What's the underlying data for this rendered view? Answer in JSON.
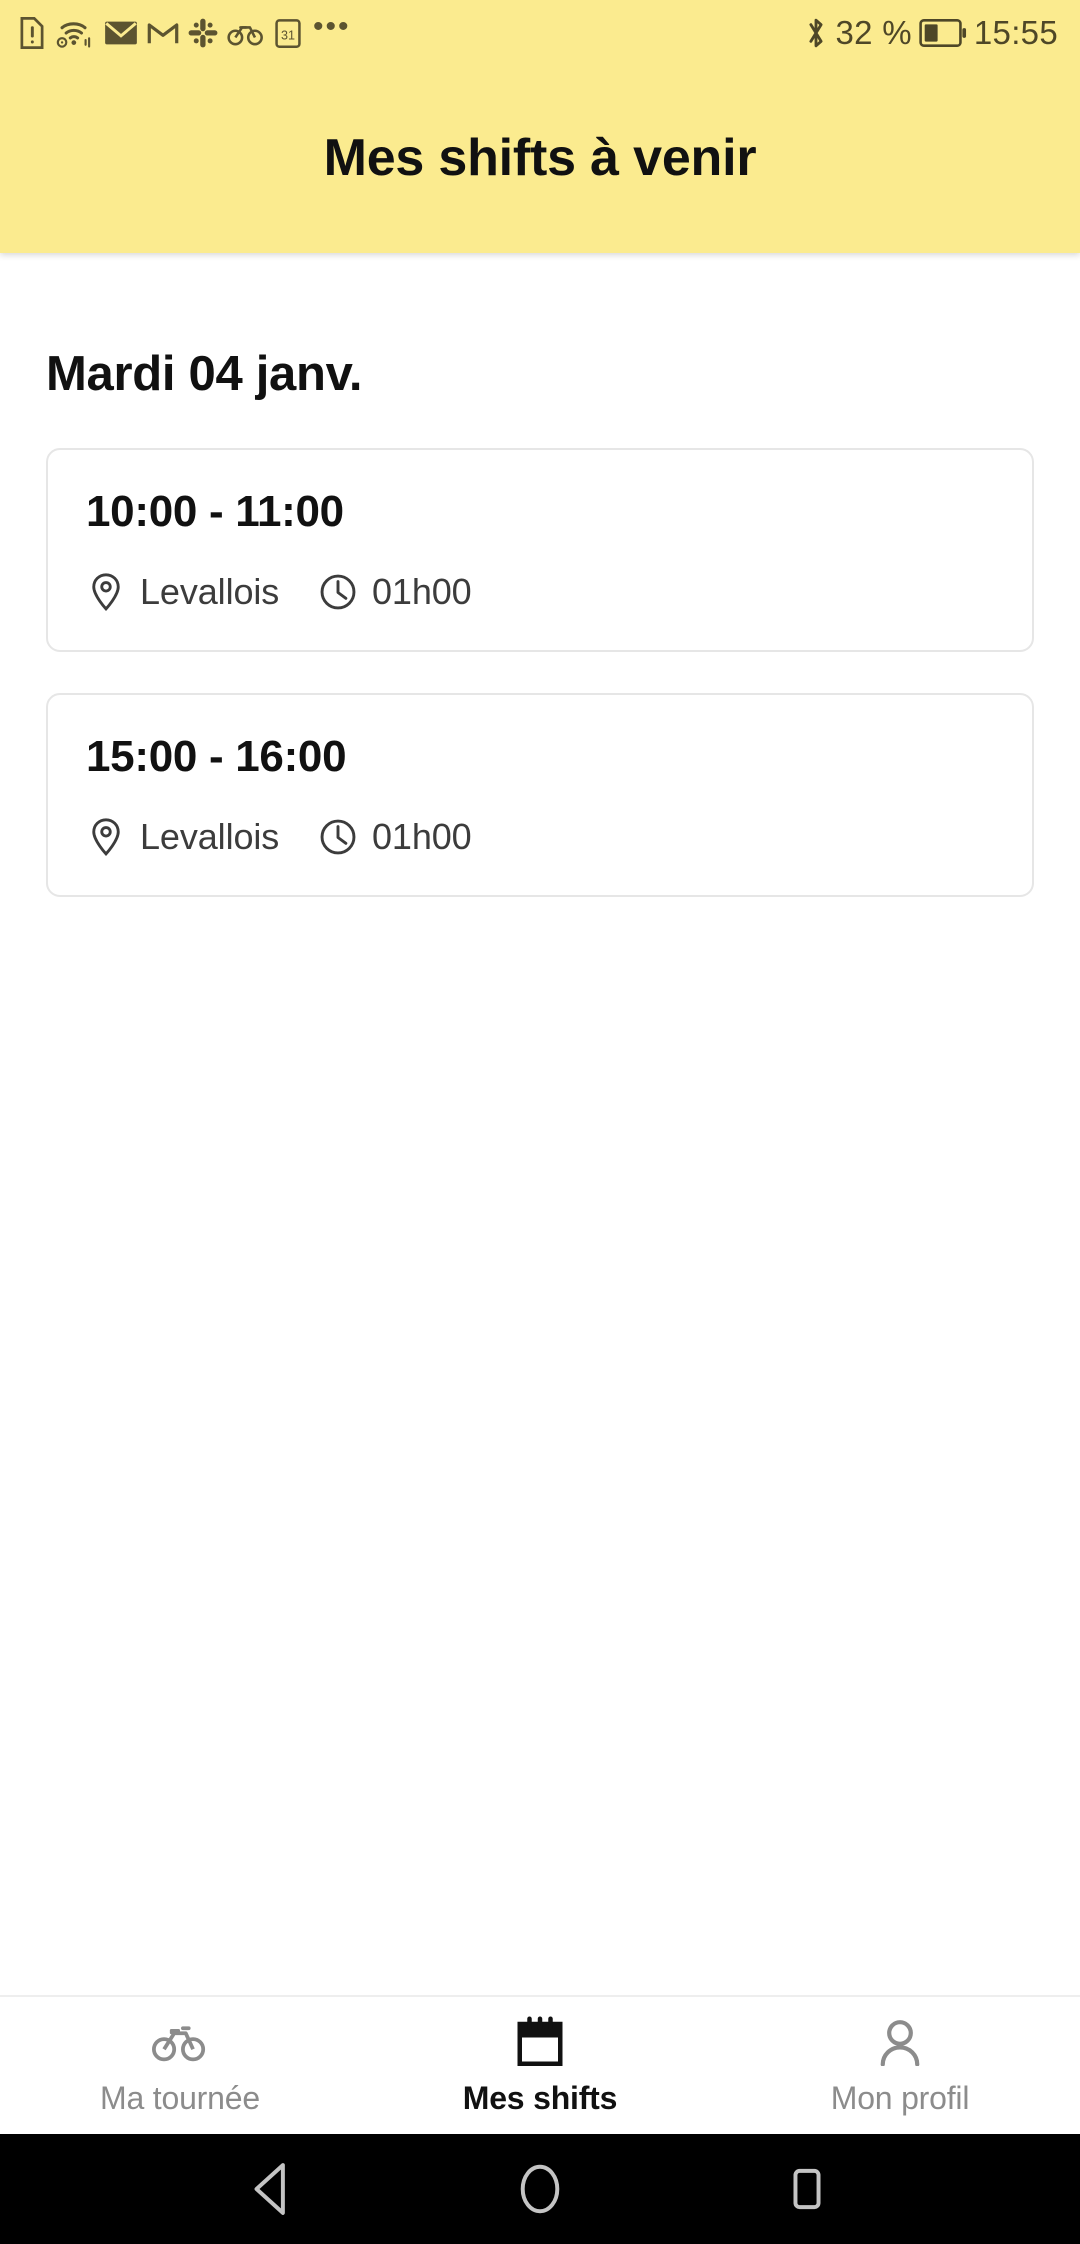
{
  "status_bar": {
    "left_icons": [
      {
        "name": "sim-alert-icon",
        "label": "SIM card alert"
      },
      {
        "name": "wifi-hotspot-icon",
        "label": "Wi-Fi hotspot"
      },
      {
        "name": "mail-icon",
        "label": "Mail"
      },
      {
        "name": "gmail-icon",
        "label": "Gmail"
      },
      {
        "name": "slack-icon",
        "label": "Slack"
      },
      {
        "name": "bike-icon",
        "label": "Bike app"
      },
      {
        "name": "calendar-icon",
        "label": "Calendar 31"
      }
    ],
    "calendar_day": "31",
    "overflow": "•••",
    "bluetooth": "bluetooth-icon",
    "battery_percent": "32 %",
    "battery_level": 32,
    "time": "15:55"
  },
  "header": {
    "title": "Mes shifts à venir",
    "background_color": "#fbeb8f",
    "title_color": "#111111"
  },
  "main": {
    "day_heading": "Mardi 04 janv.",
    "shifts": [
      {
        "time": "10:00 - 11:00",
        "location": "Levallois",
        "duration": "01h00"
      },
      {
        "time": "15:00 - 16:00",
        "location": "Levallois",
        "duration": "01h00"
      }
    ]
  },
  "tabbar": {
    "tabs": [
      {
        "label": "Ma tournée",
        "icon": "bike-icon",
        "active": false
      },
      {
        "label": "Mes shifts",
        "icon": "calendar-icon",
        "active": true
      },
      {
        "label": "Mon profil",
        "icon": "person-icon",
        "active": false
      }
    ],
    "inactive_color": "#8c8c8c",
    "active_color": "#111111"
  },
  "android_nav": {
    "back": "back-triangle-icon",
    "home": "home-circle-icon",
    "recents": "recents-square-icon"
  }
}
